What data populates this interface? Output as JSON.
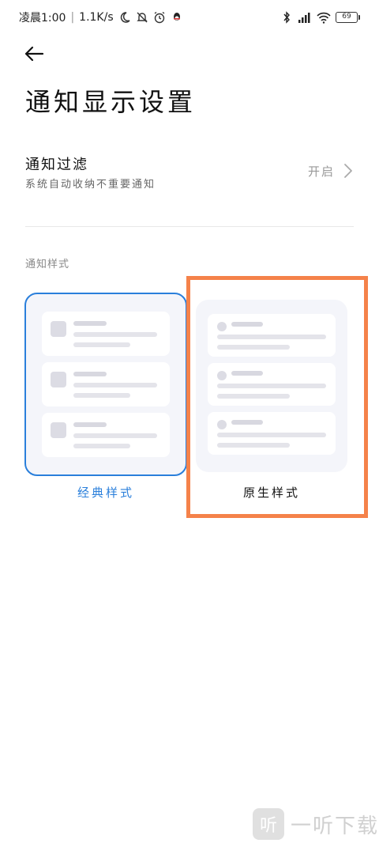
{
  "status_bar": {
    "time": "凌晨1:00",
    "net_speed": "1.1K/s",
    "battery": "69"
  },
  "page": {
    "title": "通知显示设置"
  },
  "filter": {
    "title": "通知过滤",
    "subtitle": "系统自动收纳不重要通知",
    "value": "开启"
  },
  "section": {
    "label": "通知样式"
  },
  "styles": [
    {
      "label": "经典样式",
      "selected": true
    },
    {
      "label": "原生样式",
      "selected": false
    }
  ],
  "colors": {
    "accent": "#2a7fdb",
    "highlight": "#f5824a"
  },
  "watermark": {
    "logo": "听",
    "text": "一听下载"
  }
}
